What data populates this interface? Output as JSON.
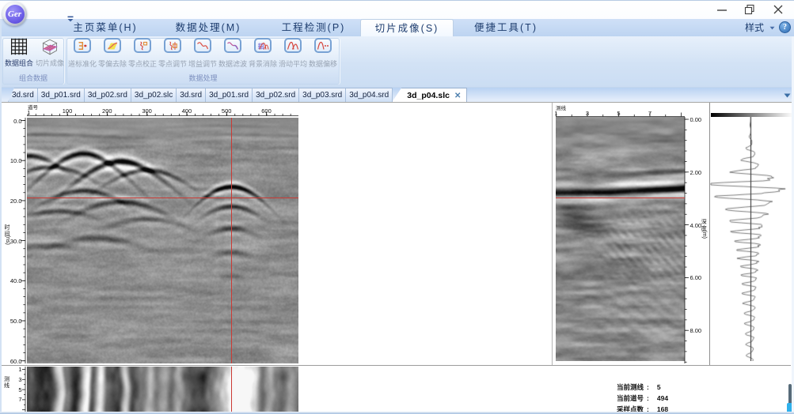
{
  "window": {
    "logo_text": "Ger",
    "controls": {
      "minimize": "minimize",
      "restore": "restore",
      "close": "close"
    }
  },
  "menu": {
    "items": [
      "主页菜单(H)",
      "数据处理(M)",
      "工程检测(P)",
      "切片成像(S)",
      "便捷工具(T)"
    ],
    "active_index": 3,
    "style_label": "样式",
    "help_glyph": "?"
  },
  "ribbon": {
    "groups": [
      {
        "title": "组合数据",
        "buttons": [
          {
            "label": "数据组合",
            "icon": "data-grid-icon",
            "enabled": true
          },
          {
            "label": "切片成像",
            "icon": "slice-cube-icon",
            "enabled": false
          }
        ]
      },
      {
        "title": "数据处理",
        "buttons": [
          {
            "label": "道标准化",
            "icon": "trace-normalize-icon",
            "enabled": false
          },
          {
            "label": "零偏去除",
            "icon": "offset-remove-icon",
            "enabled": false
          },
          {
            "label": "零点校正",
            "icon": "zero-correct-icon",
            "enabled": false
          },
          {
            "label": "零点调节",
            "icon": "zero-adjust-icon",
            "enabled": false
          },
          {
            "label": "增益调节",
            "icon": "gain-adjust-icon",
            "enabled": false
          },
          {
            "label": "数据滤波",
            "icon": "data-filter-icon",
            "enabled": false
          },
          {
            "label": "背景消除",
            "icon": "background-remove-icon",
            "enabled": false
          },
          {
            "label": "滑动平均",
            "icon": "moving-average-icon",
            "enabled": false
          },
          {
            "label": "数据偏移",
            "icon": "data-shift-icon",
            "enabled": false
          }
        ]
      }
    ]
  },
  "tabs": {
    "items": [
      "3d.srd",
      "3d_p01.srd",
      "3d_p02.srd",
      "3d_p02.slc",
      "3d.srd",
      "3d_p01.srd",
      "3d_p02.srd",
      "3d_p03.srd",
      "3d_p04.srd",
      "3d_p04.slc"
    ],
    "active_index": 9,
    "close_glyph": "✕"
  },
  "status": {
    "rows": [
      {
        "label": "当前测线",
        "sep": ":",
        "value": "5"
      },
      {
        "label": "当前道号",
        "sep": ":",
        "value": "494"
      },
      {
        "label": "采样点数",
        "sep": ":",
        "value": "168"
      }
    ]
  },
  "chart_data": [
    {
      "name": "main_radargram",
      "type": "heatmap",
      "x_axis_title": "道号",
      "x_first_tick": "1",
      "x_major_ticks": [
        "100",
        "200",
        "300",
        "400",
        "500",
        "600"
      ],
      "x_range": [
        1,
        680
      ],
      "y_axis_title": "时间(ns)",
      "y_ticks": [
        "0.0",
        "10.0",
        "20.0",
        "30.0",
        "40.0",
        "50.0",
        "60.0"
      ],
      "y_range": [
        0,
        61.5
      ],
      "crosshair": {
        "trace": 494,
        "time_ns": 20.0
      },
      "colormap": "grayscale"
    },
    {
      "name": "crossline_section",
      "type": "heatmap",
      "x_axis_title": "测线",
      "x_ticks": [
        "1",
        "3",
        "5",
        "7"
      ],
      "x_range": [
        1,
        9.3
      ],
      "y_axis_title": "深度(m)",
      "y_ticks": [
        "0.00",
        "2.00",
        "4.00",
        "6.00",
        "8.00"
      ],
      "y_range": [
        0,
        9.25
      ],
      "marker_time": 2.97,
      "colormap": "grayscale"
    },
    {
      "name": "depth_slice",
      "type": "heatmap",
      "y_axis_title": "测线",
      "y_ticks": [
        "1",
        "3",
        "5",
        "7"
      ],
      "crosshair_trace": 494,
      "colormap": "grayscale"
    },
    {
      "name": "trace_waveform",
      "type": "line",
      "description": "single-trace amplitude wiggle"
    }
  ]
}
